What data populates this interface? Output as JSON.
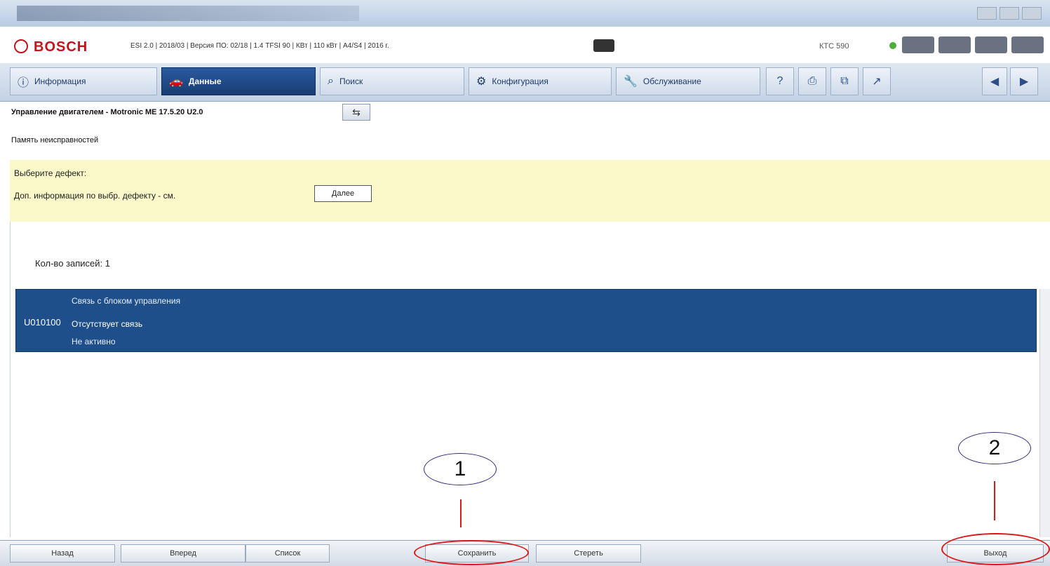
{
  "header": {
    "brand": "BOSCH",
    "vehicle_info": "ESI 2.0 | 2018/03 | Версия ПО: 02/18 | 1.4 TFSI 90 | КВт | 110 кВт | A4/S4 | 2016 г.",
    "status": "КТС 590"
  },
  "nav": {
    "tabs": [
      {
        "label": "Информация",
        "icon": "info-icon"
      },
      {
        "label": "Данные",
        "icon": "car-icon"
      },
      {
        "label": "Поиск",
        "icon": "search-icon"
      },
      {
        "label": "Конфигурация",
        "icon": "gear-icon"
      },
      {
        "label": "Обслуживание",
        "icon": "wrench-icon"
      }
    ],
    "small": [
      "help-icon",
      "print-icon",
      "window-icon"
    ]
  },
  "breadcrumb": "Управление двигателем - Motronic ME 17.5.20 U2.0",
  "subtitle": "Память неисправностей",
  "notice": {
    "line1": "Выберите дефект:",
    "line2": "Доп. информация по выбр. дефекту - см.",
    "button": "Далее"
  },
  "fault_count": "Кол-во записей: 1",
  "fault": {
    "code": "U010100",
    "line1": "Связь с блоком управления",
    "line2": "Отсутствует связь",
    "line3": "Не активно"
  },
  "bottom": {
    "b1": "Назад",
    "b2": "Вперед",
    "b3": "Список",
    "b4": "Сохранить",
    "b5": "Стереть",
    "b6": "Выход"
  },
  "callouts": {
    "c1": "1",
    "c2": "2"
  },
  "colors": {
    "brand_red": "#c3131b",
    "selection_blue": "#1f4f8b",
    "notice_yellow": "#fbf8c9",
    "annotation_red": "#e01515"
  }
}
